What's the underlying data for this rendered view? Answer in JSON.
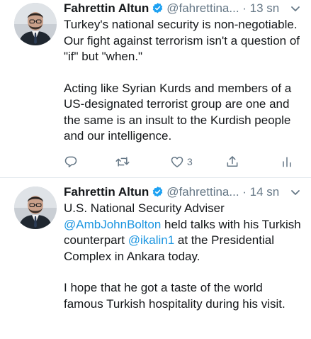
{
  "colors": {
    "text": "#14171a",
    "secondary": "#657786",
    "link": "#1b95e0",
    "verified": "#1da1f2",
    "divider": "#e1e8ed"
  },
  "tweets": [
    {
      "author": "Fahrettin Altun",
      "handle": "@fahrettina...",
      "separator": "·",
      "time": "13 sn",
      "paragraphs": [
        "Turkey's national security is non-negotiable. Our fight against terrorism isn't a question of \"if\" but \"when.\"",
        "Acting like Syrian Kurds and members of a US-designated terrorist group are one and the same is an insult to the Kurdish people and our intelligence."
      ],
      "actions": {
        "reply_icon": "reply-icon",
        "retweet_icon": "retweet-icon",
        "like_icon": "heart-icon",
        "like_count": "3",
        "share_icon": "share-icon",
        "analytics_icon": "analytics-icon"
      }
    },
    {
      "author": "Fahrettin Altun",
      "handle": "@fahrettina...",
      "separator": "·",
      "time": "14 sn",
      "body": {
        "t1": "U.S. National Security Adviser ",
        "m1": "@AmbJohnBolton",
        "t2": " held talks with his Turkish counterpart ",
        "m2": "@ikalin1",
        "t3": " at the Presidential Complex in Ankara today.",
        "p2": "I hope that he got a taste of the world famous Turkish hospitality during his visit."
      }
    }
  ]
}
